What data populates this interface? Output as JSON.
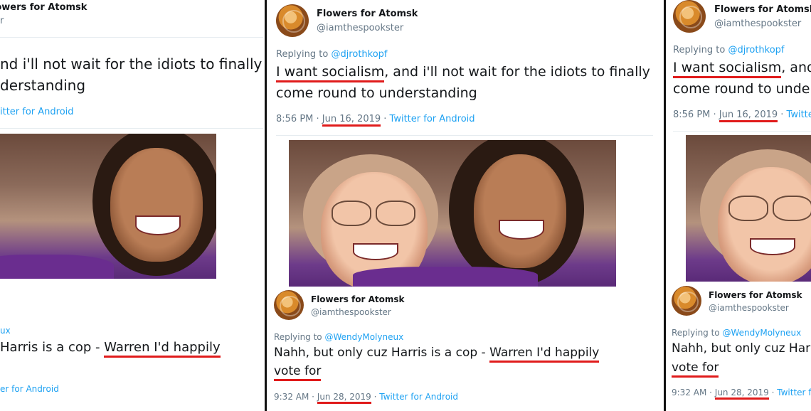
{
  "tweet1": {
    "name": "Flowers for Atomsk",
    "handle": "@iamthespookster",
    "replying_prefix": "Replying to ",
    "replying_to": "@djrothkopf",
    "text_line1_highlight": "I want socialism",
    "text_line1_rest": ", and i'll not wait for the idiots to finally",
    "text_line2": "come round to understanding",
    "time": "8:56 PM",
    "sep": " · ",
    "date": "Jun 16, 2019",
    "client": "Twitter for Android"
  },
  "tweet2": {
    "name": "Flowers for Atomsk",
    "handle": "@iamthespookster",
    "replying_prefix": "Replying to ",
    "replying_to": "@WendyMolyneux",
    "text_line1_plain": "Nahh, but only cuz Harris is a cop - ",
    "text_line1_highlight": "Warren I'd happily",
    "text_line2_highlight": "vote for",
    "time": "9:32 AM",
    "sep": " · ",
    "date": "Jun 28, 2019",
    "client": "Twitter for Android"
  },
  "left_crop": {
    "name_fragment": "msk",
    "handle_fragment": "r",
    "text_line1": "nd i'll not wait for the idiots to finally",
    "text_line2": "derstanding",
    "client_fragment": "itter for Android",
    "replying_fragment": "ux",
    "text2_plain": "Harris is a cop - ",
    "text2_highlight": "Warren I'd happily",
    "client2_fragment": "er for Android"
  },
  "colors": {
    "underline": "#e01b1b",
    "link": "#1da1f2",
    "muted": "#657786",
    "text": "#14171a"
  }
}
